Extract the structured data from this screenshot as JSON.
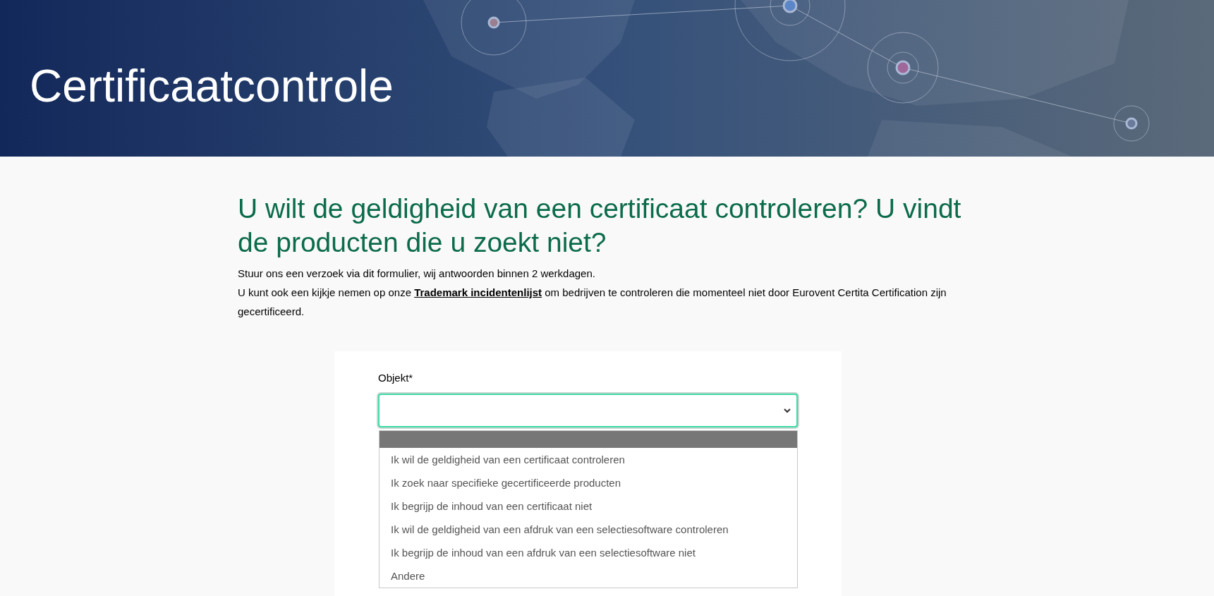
{
  "header": {
    "title": "Certificaatcontrole"
  },
  "intro": {
    "heading": "U wilt de geldigheid van een certificaat controleren? U vindt de producten die u zoekt niet?",
    "lines": [
      {
        "parts": [
          {
            "text": "Stuur ons een verzoek via dit formulier, wij antwoorden binnen 2 werkdagen."
          }
        ]
      },
      {
        "parts": [
          {
            "text": "U kunt ook een kijkje nemen op onze "
          },
          {
            "text": "Trademark incidentenlijst",
            "kind": "link"
          },
          {
            "text": " om bedrijven te controleren die momenteel niet door Eurovent Certita Certification zijn gecertificeerd."
          }
        ]
      }
    ]
  },
  "form": {
    "field_label": "Objekt*",
    "select": {
      "focused": true,
      "open": true,
      "blank_option_highlighted": true,
      "options": [
        {
          "label": "Ik wil de geldigheid van een certificaat controleren",
          "selected": false
        },
        {
          "label": "Ik zoek naar specifieke gecertificeerde producten",
          "selected": false
        },
        {
          "label": "Ik begrijp de inhoud van een certificaat niet",
          "selected": false
        },
        {
          "label": "Ik wil de geldigheid van een afdruk van een selectiesoftware controleren",
          "selected": false
        },
        {
          "label": "Ik begrijp de inhoud van een afdruk van een selectiesoftware niet",
          "selected": false
        },
        {
          "label": "Andere",
          "selected": false
        }
      ]
    }
  }
}
